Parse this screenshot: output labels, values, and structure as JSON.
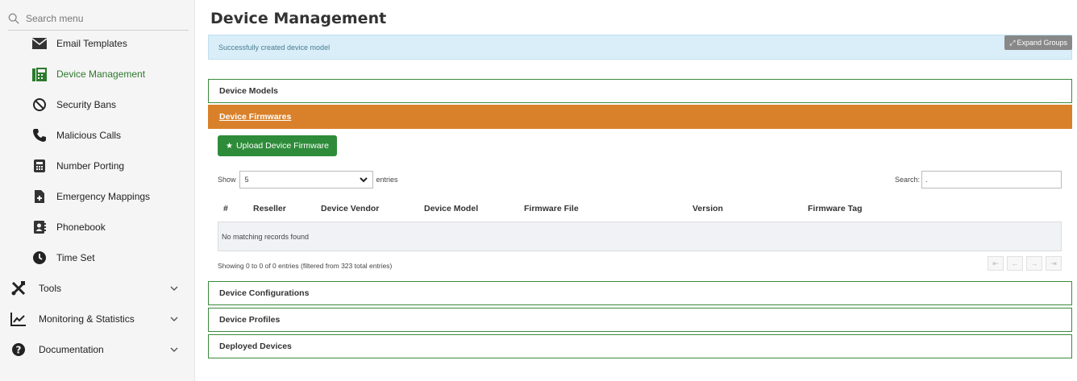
{
  "sidebar": {
    "search_placeholder": "Search menu",
    "items": [
      {
        "label": "Email Templates",
        "icon": "envelope-icon"
      },
      {
        "label": "Device Management",
        "icon": "fax-icon",
        "active": true
      },
      {
        "label": "Security Bans",
        "icon": "ban-icon"
      },
      {
        "label": "Malicious Calls",
        "icon": "phone-icon"
      },
      {
        "label": "Number Porting",
        "icon": "calculator-icon"
      },
      {
        "label": "Emergency Mappings",
        "icon": "medical-file-icon"
      },
      {
        "label": "Phonebook",
        "icon": "address-book-icon"
      },
      {
        "label": "Time Set",
        "icon": "clock-icon"
      }
    ],
    "groups": [
      {
        "label": "Tools",
        "icon": "tools-icon"
      },
      {
        "label": "Monitoring & Statistics",
        "icon": "chart-icon"
      },
      {
        "label": "Documentation",
        "icon": "question-icon"
      }
    ]
  },
  "page": {
    "title": "Device Management",
    "alert": "Successfully created device model",
    "expand_label": "Expand Groups"
  },
  "panels": {
    "device_models": "Device Models",
    "device_firmwares": "Device Firmwares",
    "device_configurations": "Device Configurations",
    "device_profiles": "Device Profiles",
    "deployed_devices": "Deployed Devices"
  },
  "firmware": {
    "upload_label": "Upload Device Firmware",
    "show_label": "Show",
    "page_size": "5",
    "entries_label": "entries",
    "search_label": "Search:",
    "search_value": ".",
    "columns": [
      "#",
      "Reseller",
      "Device Vendor",
      "Device Model",
      "Firmware File",
      "Version",
      "Firmware Tag"
    ],
    "empty_message": "No matching records found",
    "info": "Showing 0 to 0 of 0 entries (filtered from 323 total entries)",
    "pager": [
      "⇤",
      "←",
      "→",
      "⇥"
    ]
  },
  "colors": {
    "accent_green": "#2e8b3a",
    "active_orange": "#d9812a",
    "alert_bg": "#d9eef8"
  }
}
